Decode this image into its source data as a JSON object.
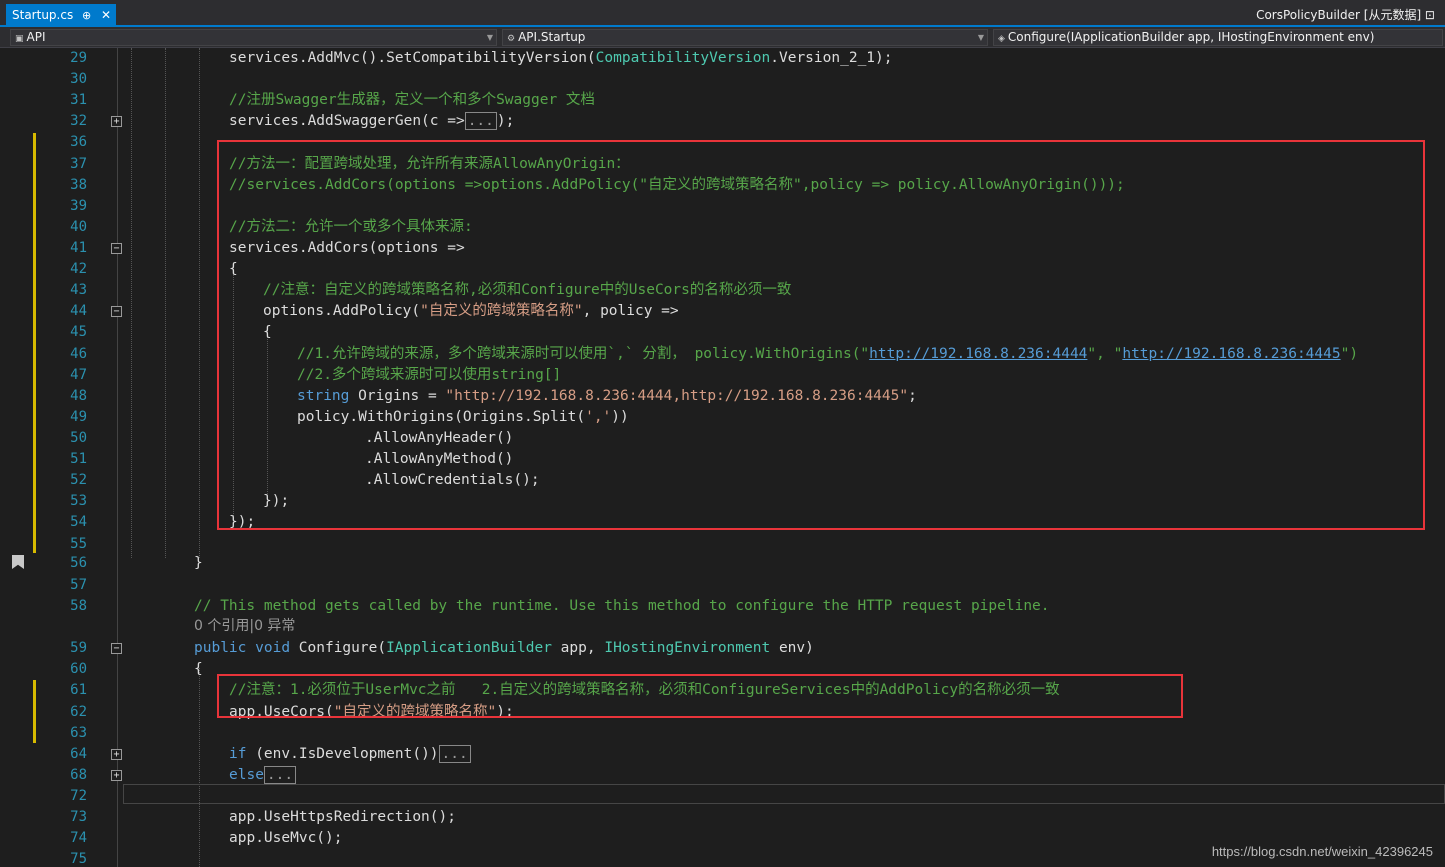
{
  "tab": {
    "title": "Startup.cs",
    "pin": "⊕",
    "close": "✕"
  },
  "meta_title": "CorsPolicyBuilder [从元数据] ⊡",
  "nav": {
    "project": "API",
    "class": "API.Startup",
    "member": "Configure(IApplicationBuilder app, IHostingEnvironment env)"
  },
  "lines": [
    {
      "n": "29",
      "segs": [
        [
          "pl",
          "services.AddMvc().SetCompatibilityVersion("
        ],
        [
          "ty",
          "CompatibilityVersion"
        ],
        [
          "pl",
          ".Version_2_1);"
        ]
      ]
    },
    {
      "n": "30",
      "segs": []
    },
    {
      "n": "31",
      "segs": [
        [
          "cm",
          "//注册Swagger生成器，定义一个和多个Swagger 文档"
        ]
      ]
    },
    {
      "n": "32",
      "segs": [
        [
          "pl",
          "services.AddSwaggerGen(c =>"
        ],
        [
          "col",
          "..."
        ],
        [
          "pl",
          ");"
        ]
      ]
    },
    {
      "n": "36",
      "segs": []
    },
    {
      "n": "37",
      "segs": [
        [
          "cm",
          "//方法一：配置跨域处理，允许所有来源AllowAnyOrigin："
        ]
      ]
    },
    {
      "n": "38",
      "segs": [
        [
          "cm",
          "//services.AddCors(options =>options.AddPolicy(\"自定义的跨域策略名称\",policy => policy.AllowAnyOrigin()));"
        ]
      ]
    },
    {
      "n": "39",
      "segs": []
    },
    {
      "n": "40",
      "segs": [
        [
          "cm",
          "//方法二：允许一个或多个具体来源:"
        ]
      ]
    },
    {
      "n": "41",
      "segs": [
        [
          "pl",
          "services.AddCors(options =>"
        ]
      ]
    },
    {
      "n": "42",
      "segs": [
        [
          "pl",
          "{"
        ]
      ]
    },
    {
      "n": "43",
      "segs": [
        [
          "cm",
          "//注意：自定义的跨域策略名称,必须和Configure中的UseCors的名称必须一致"
        ]
      ]
    },
    {
      "n": "44",
      "segs": [
        [
          "pl",
          "options.AddPolicy("
        ],
        [
          "str",
          "\"自定义的跨域策略名称\""
        ],
        [
          "pl",
          ", policy =>"
        ]
      ]
    },
    {
      "n": "45",
      "segs": [
        [
          "pl",
          "{"
        ]
      ]
    },
    {
      "n": "46",
      "segs": [
        [
          "cm",
          "//1.允许跨域的来源，多个跨域来源时可以使用`,` 分割， policy.WithOrigins(\""
        ],
        [
          "url",
          "http://192.168.8.236:4444"
        ],
        [
          "cm",
          "\", \""
        ],
        [
          "url",
          "http://192.168.8.236:4445"
        ],
        [
          "cm",
          "\")"
        ]
      ]
    },
    {
      "n": "47",
      "segs": [
        [
          "cm",
          "//2.多个跨域来源时可以使用string[]"
        ]
      ]
    },
    {
      "n": "48",
      "segs": [
        [
          "kw",
          "string"
        ],
        [
          "pl",
          " Origins = "
        ],
        [
          "str",
          "\"http://192.168.8.236:4444,http://192.168.8.236:4445\""
        ],
        [
          "pl",
          ";"
        ]
      ]
    },
    {
      "n": "49",
      "segs": [
        [
          "pl",
          "policy.WithOrigins(Origins.Split("
        ],
        [
          "str",
          "','"
        ],
        [
          "pl",
          "))"
        ]
      ]
    },
    {
      "n": "50",
      "segs": [
        [
          "pl",
          ".AllowAnyHeader()"
        ]
      ]
    },
    {
      "n": "51",
      "segs": [
        [
          "pl",
          ".AllowAnyMethod()"
        ]
      ]
    },
    {
      "n": "52",
      "segs": [
        [
          "pl",
          ".AllowCredentials();"
        ]
      ]
    },
    {
      "n": "53",
      "segs": [
        [
          "pl",
          "});"
        ]
      ]
    },
    {
      "n": "54",
      "segs": [
        [
          "pl",
          "});"
        ]
      ]
    },
    {
      "n": "55",
      "segs": []
    },
    {
      "n": "56",
      "segs": [
        [
          "pl",
          "}"
        ]
      ]
    },
    {
      "n": "57",
      "segs": []
    },
    {
      "n": "58",
      "segs": [
        [
          "cm",
          "// This method gets called by the runtime. Use this method to configure the HTTP request pipeline."
        ]
      ]
    },
    {
      "n": "59",
      "segs": [
        [
          "kw",
          "public"
        ],
        [
          "pl",
          " "
        ],
        [
          "kw",
          "void"
        ],
        [
          "pl",
          " Configure("
        ],
        [
          "ty",
          "IApplicationBuilder"
        ],
        [
          "pl",
          " app, "
        ],
        [
          "ty",
          "IHostingEnvironment"
        ],
        [
          "pl",
          " env)"
        ]
      ]
    },
    {
      "n": "60",
      "segs": [
        [
          "pl",
          "{"
        ]
      ]
    },
    {
      "n": "61",
      "segs": [
        [
          "cm",
          "//注意：1.必须位于UserMvc之前   2.自定义的跨域策略名称，必须和ConfigureServices中的AddPolicy的名称必须一致"
        ]
      ]
    },
    {
      "n": "62",
      "segs": [
        [
          "pl",
          "app.UseCors("
        ],
        [
          "str",
          "\"自定义的跨域策略名称\""
        ],
        [
          "pl",
          ");"
        ]
      ]
    },
    {
      "n": "63",
      "segs": []
    },
    {
      "n": "64",
      "segs": [
        [
          "kw",
          "if"
        ],
        [
          "pl",
          " (env.IsDevelopment())"
        ],
        [
          "col",
          "..."
        ]
      ]
    },
    {
      "n": "68",
      "segs": [
        [
          "kw",
          "else"
        ],
        [
          "col",
          "..."
        ]
      ]
    },
    {
      "n": "72",
      "segs": []
    },
    {
      "n": "73",
      "segs": [
        [
          "pl",
          "app.UseHttpsRedirection();"
        ]
      ]
    },
    {
      "n": "74",
      "segs": [
        [
          "pl",
          "app.UseMvc();"
        ]
      ]
    },
    {
      "n": "75",
      "segs": []
    }
  ],
  "codelens": "0 个引用|0 异常",
  "watermark": "https://blog.csdn.net/weixin_42396245",
  "colors": {
    "highlight_box": "#e8343a",
    "accent": "#007acc",
    "change_marker": "#d7ba00"
  }
}
